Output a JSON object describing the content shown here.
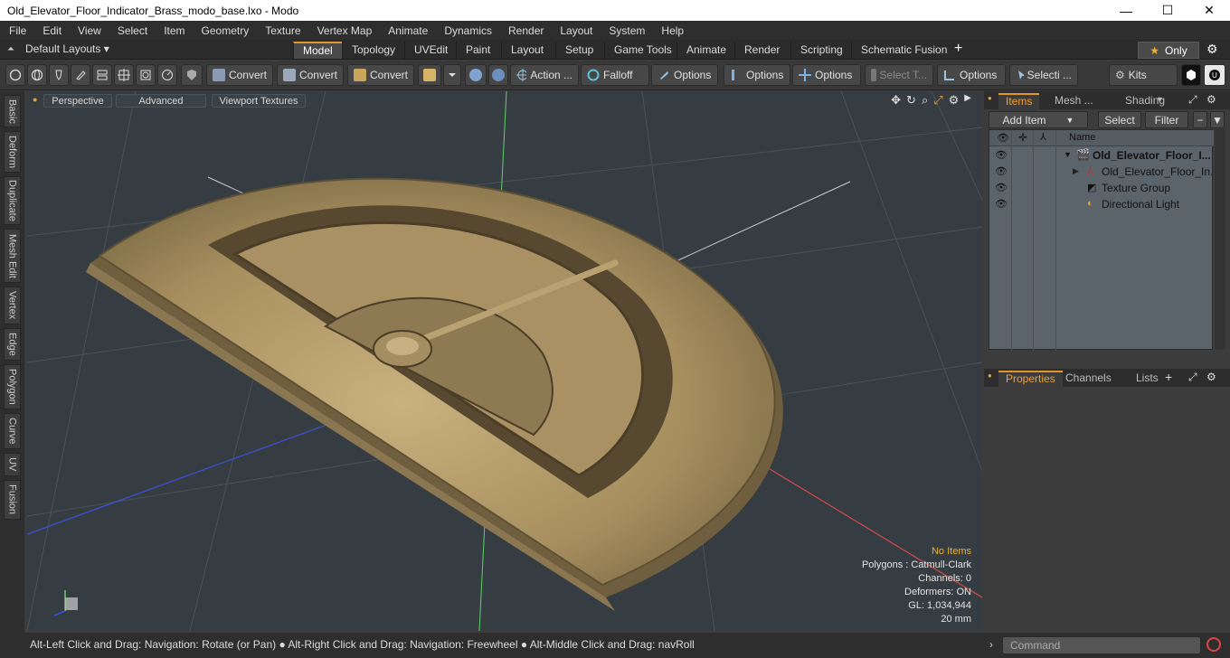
{
  "window": {
    "title": "Old_Elevator_Floor_Indicator_Brass_modo_base.lxo - Modo",
    "minimize": "—",
    "maximize": "☐",
    "close": "✕"
  },
  "menu": [
    "File",
    "Edit",
    "View",
    "Select",
    "Item",
    "Geometry",
    "Texture",
    "Vertex Map",
    "Animate",
    "Dynamics",
    "Render",
    "Layout",
    "System",
    "Help"
  ],
  "layouts": {
    "label": "Default Layouts ▾"
  },
  "tabs": [
    {
      "label": "Model",
      "active": true
    },
    {
      "label": "Topology"
    },
    {
      "label": "UVEdit"
    },
    {
      "label": "Paint"
    },
    {
      "label": "Layout"
    },
    {
      "label": "Setup"
    },
    {
      "label": "Game Tools"
    },
    {
      "label": "Animate"
    },
    {
      "label": "Render"
    },
    {
      "label": "Scripting"
    },
    {
      "label": "Schematic Fusion"
    }
  ],
  "tabbar_extra": {
    "plus": "+",
    "only": "Only",
    "star": "★",
    "gear": "⚙"
  },
  "toolbar": {
    "convert1": "Convert",
    "convert2": "Convert",
    "convert3": "Convert",
    "action": "Action ...",
    "falloff": "Falloff",
    "options1": "Options",
    "options2": "Options",
    "options3": "Options",
    "select_t": "Select T...",
    "options4": "Options",
    "selecti": "Selecti ...",
    "kits": "Kits"
  },
  "left_tabs": [
    "Basic",
    "Deform",
    "Duplicate",
    "Mesh Edit",
    "Vertex",
    "Edge",
    "Polygon",
    "Curve",
    "UV",
    "Fusion"
  ],
  "viewport": {
    "perspective": "Perspective",
    "advanced": "Advanced",
    "textures": "Viewport Textures",
    "hud": {
      "no_items": "No Items",
      "polygons": "Polygons : Catmull-Clark",
      "channels": "Channels: 0",
      "deformers": "Deformers: ON",
      "gl": "GL: 1,034,944",
      "distance": "20 mm"
    }
  },
  "items_panel": {
    "tabs": [
      "Items",
      "Mesh ...",
      "Shading"
    ],
    "add_item": "Add Item",
    "select": "Select",
    "filter": "Filter",
    "name_header": "Name",
    "rows": [
      {
        "label": "Old_Elevator_Floor_I..."
      },
      {
        "label": "Old_Elevator_Floor_In..."
      },
      {
        "label": "Texture Group"
      },
      {
        "label": "Directional Light"
      }
    ]
  },
  "properties_panel": {
    "tabs": [
      "Properties",
      "Channels",
      "Lists"
    ],
    "plus": "+"
  },
  "status": {
    "message": "Alt-Left Click and Drag: Navigation: Rotate (or Pan) ● Alt-Right Click and Drag: Navigation: Freewheel ● Alt-Middle Click and Drag: navRoll",
    "command_placeholder": "Command"
  },
  "colors": {
    "accent": "#e0962a",
    "viewport_bg": "#363d42",
    "brass": "#b39a68",
    "outliner_bg": "#5c646b"
  }
}
